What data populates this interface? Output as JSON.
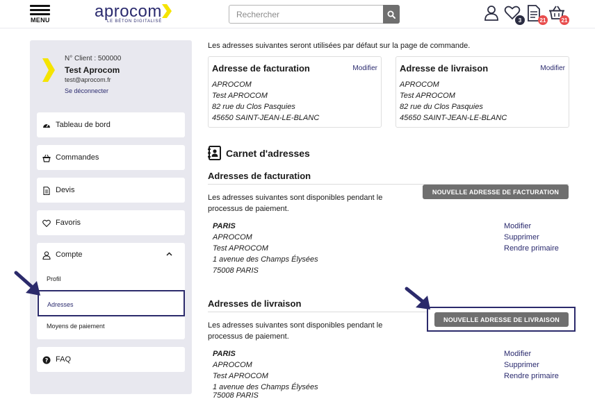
{
  "header": {
    "menu_label": "MENU",
    "logo_text": "aprocom",
    "logo_tagline": "LE BÉTON DIGITALISÉ",
    "search_placeholder": "Rechercher",
    "favorites_count": "3",
    "quotes_count": "21",
    "cart_count": "21"
  },
  "sidebar": {
    "client_number": "N° Client : 500000",
    "client_name": "Test Aprocom",
    "client_email": "test@aprocom.fr",
    "logout_label": "Se déconnecter",
    "items": [
      {
        "label": "Tableau de bord",
        "icon": "dashboard-icon"
      },
      {
        "label": "Commandes",
        "icon": "basket-icon"
      },
      {
        "label": "Devis",
        "icon": "document-icon"
      },
      {
        "label": "Favoris",
        "icon": "heart-icon"
      }
    ],
    "account": {
      "label": "Compte",
      "sub_items": [
        "Profil",
        "Adresses",
        "Moyens de paiement"
      ],
      "active": "Adresses"
    },
    "faq_label": "FAQ"
  },
  "main": {
    "intro": "Les adresses suivantes seront utilisées par défaut sur la page de commande.",
    "billing_default": {
      "title": "Adresse de facturation",
      "edit_label": "Modifier",
      "lines": [
        "APROCOM",
        "Test APROCOM",
        "82 rue du Clos Pasquies",
        "45650 SAINT-JEAN-LE-BLANC"
      ]
    },
    "shipping_default": {
      "title": "Adresse de livraison",
      "edit_label": "Modifier",
      "lines": [
        "APROCOM",
        "Test APROCOM",
        "82 rue du Clos Pasquies",
        "45650 SAINT-JEAN-LE-BLANC"
      ]
    },
    "address_book_title": "Carnet d'adresses",
    "billing_section": {
      "title": "Adresses de facturation",
      "description_1": "Les adresses suivantes sont disponibles pendant le",
      "description_2": "processus de paiement.",
      "new_button": "NOUVELLE ADRESSE DE FACTURATION",
      "address": [
        "PARIS",
        "APROCOM",
        "Test APROCOM",
        "1 avenue des Champs Élysées",
        "75008 PARIS"
      ],
      "actions": [
        "Modifier",
        "Supprimer",
        "Rendre primaire"
      ]
    },
    "shipping_section": {
      "title": "Adresses de livraison",
      "description_1": "Les adresses suivantes sont disponibles pendant le",
      "description_2": "processus de paiement.",
      "new_button": "NOUVELLE ADRESSE DE LIVRAISON",
      "address": [
        "PARIS",
        "APROCOM",
        "Test APROCOM",
        "1 avenue des Champs Élysées",
        "75008 PARIS"
      ],
      "actions": [
        "Modifier",
        "Supprimer",
        "Rendre primaire"
      ]
    }
  },
  "colors": {
    "brand_navy": "#2a2a6e",
    "brand_yellow": "#f5e400",
    "button_gray": "#6f6f6f",
    "sidebar_bg": "#e8e8ef",
    "badge_red": "#e84d4d"
  }
}
